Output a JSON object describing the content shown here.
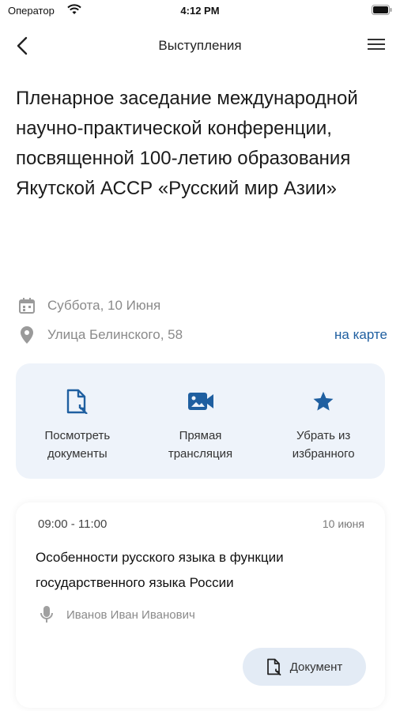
{
  "status_bar": {
    "carrier": "Оператор",
    "time": "4:12 PM"
  },
  "nav": {
    "title": "Выступления"
  },
  "event": {
    "title": "Пленарное заседание международной научно-практической конференции, посвященной 100-летию образования Якутской АССР «Русский мир Азии»",
    "date": "Суббота, 10 Июня",
    "address": "Улица Белинского, 58",
    "map_link": "на карте"
  },
  "actions": [
    {
      "label": "Посмотреть\nдокументы",
      "icon": "document-icon"
    },
    {
      "label": "Прямая\nтрансляция",
      "icon": "video-camera-icon"
    },
    {
      "label": "Убрать из\nизбранного",
      "icon": "star-icon"
    }
  ],
  "talk": {
    "time": "09:00 - 11:00",
    "date": "10 июня",
    "title": "Особенности русского языка в функции государственного языка России",
    "speaker": "Иванов Иван Иванович",
    "document_button": "Документ"
  },
  "colors": {
    "accent": "#1f5fa0",
    "card_background": "#eef3fa",
    "button_background": "#e3ebf5",
    "muted_text": "#8a8a8a"
  }
}
